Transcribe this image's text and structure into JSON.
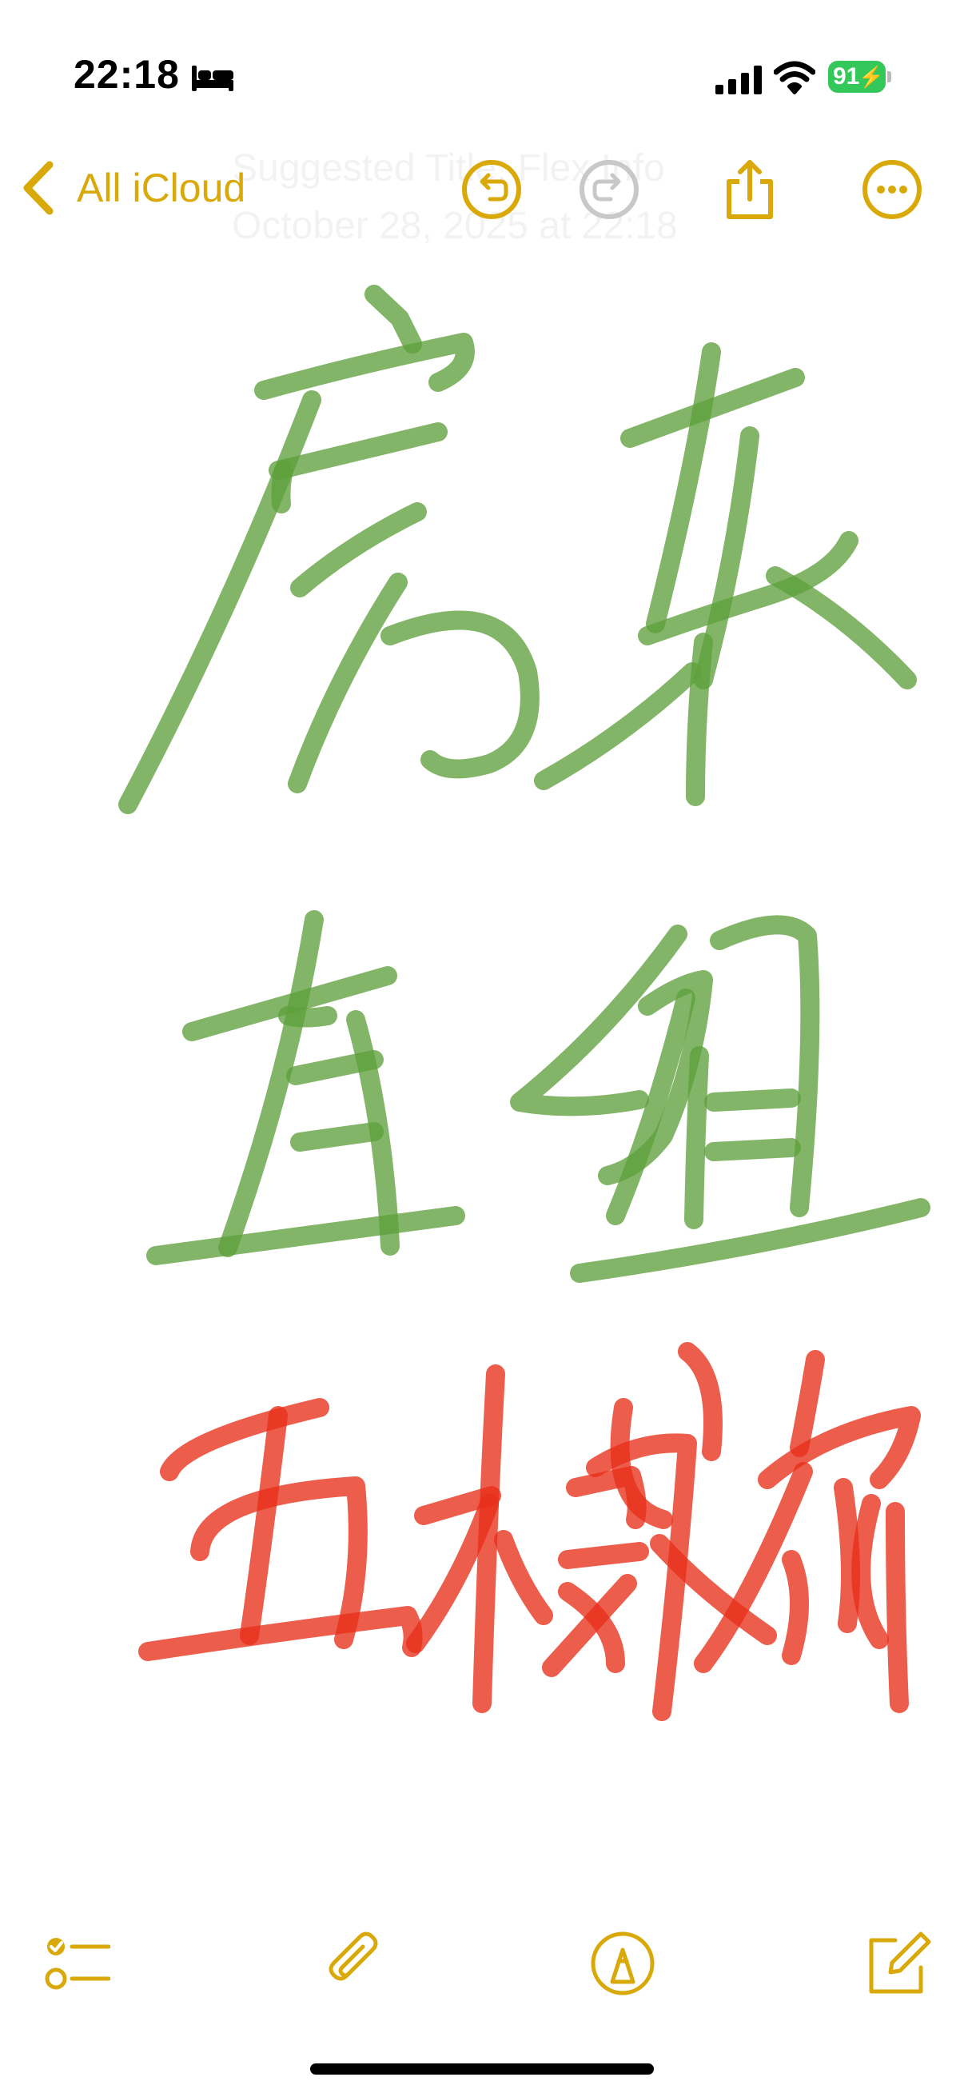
{
  "status_bar": {
    "time": "22:18",
    "battery_level": "91",
    "icons": [
      "bed-icon",
      "signal-icon",
      "wifi-icon",
      "battery-icon"
    ],
    "battery_color": "#34c759"
  },
  "nav_bar": {
    "back_label": "All iCloud",
    "suggested_title": "Suggested Title: Flex Info October 28, 2025 at 22:18",
    "icons": [
      "undo-icon",
      "redo-icon",
      "share-icon",
      "more-icon"
    ],
    "accent_color": "#d9a90a"
  },
  "canvas": {
    "ink_colors": [
      "#5fa03c",
      "#e8301a"
    ]
  },
  "toolbar": {
    "icons": [
      "checklist-icon",
      "attachment-icon",
      "markup-icon",
      "compose-icon"
    ]
  }
}
